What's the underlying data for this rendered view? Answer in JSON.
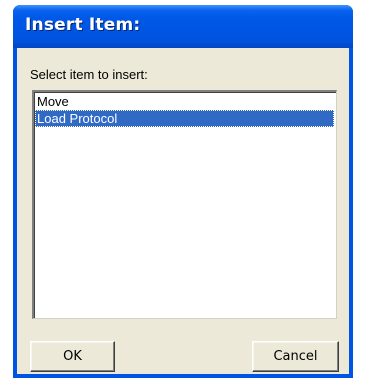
{
  "window": {
    "title": "Insert Item:"
  },
  "prompt": "Select item to insert:",
  "list": {
    "items": [
      {
        "label": "Move",
        "selected": false
      },
      {
        "label": "Load Protocol",
        "selected": true
      }
    ]
  },
  "buttons": {
    "ok_label": "OK",
    "cancel_label": "Cancel"
  },
  "colors": {
    "titlebar": "#0054e3",
    "dialog_face": "#ece9d8",
    "selection": "#316ac5"
  }
}
